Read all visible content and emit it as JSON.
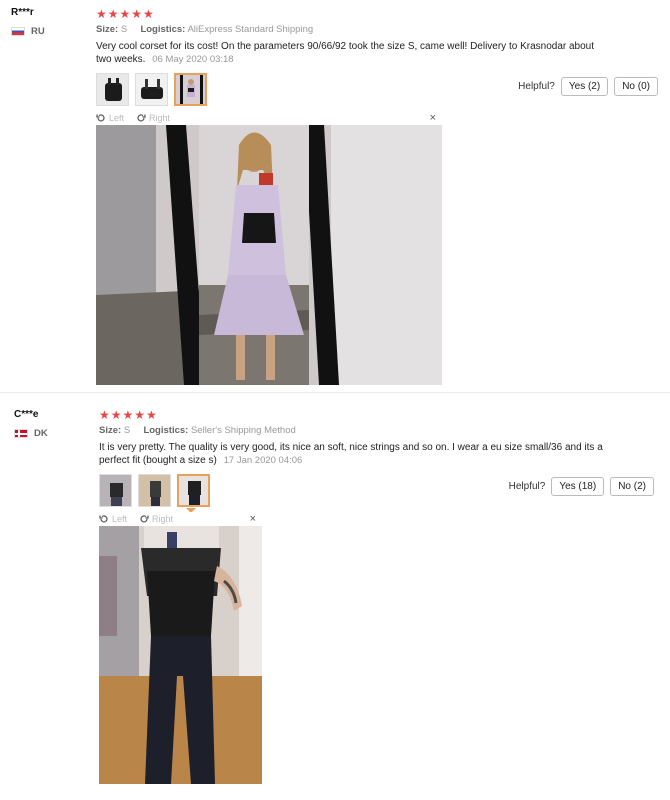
{
  "reviews": [
    {
      "user": "R***r",
      "country": "RU",
      "stars": "★★★★★",
      "size_label": "Size:",
      "size_value": "S",
      "logistics_label": "Logistics:",
      "logistics_value": "AliExpress Standard Shipping",
      "text": "Very cool corset for its cost! On the parameters 90/66/92 took the size S, came well! Delivery to Krasnodar about two weeks.",
      "date": "06 May 2020 03:18",
      "helpful_label": "Helpful?",
      "yes_label": "Yes (2)",
      "no_label": "No (0)",
      "viewer": {
        "left_label": "Left",
        "right_label": "Right",
        "close_icon": "×"
      }
    },
    {
      "user": "C***e",
      "country": "DK",
      "stars": "★★★★★",
      "size_label": "Size:",
      "size_value": "S",
      "logistics_label": "Logistics:",
      "logistics_value": "Seller's Shipping Method",
      "text": "It is very pretty. The quality is very good, its nice an soft, nice strings and so on. I wear a eu size small/36 and its a perfect fit (bought a size s)",
      "date": "17 Jan 2020 04:06",
      "helpful_label": "Helpful?",
      "yes_label": "Yes (18)",
      "no_label": "No (2)",
      "viewer": {
        "left_label": "Left",
        "right_label": "Right",
        "close_icon": "×"
      }
    }
  ],
  "colors": {
    "star": "#e8474a",
    "active_thumb": "#e8a05a"
  }
}
